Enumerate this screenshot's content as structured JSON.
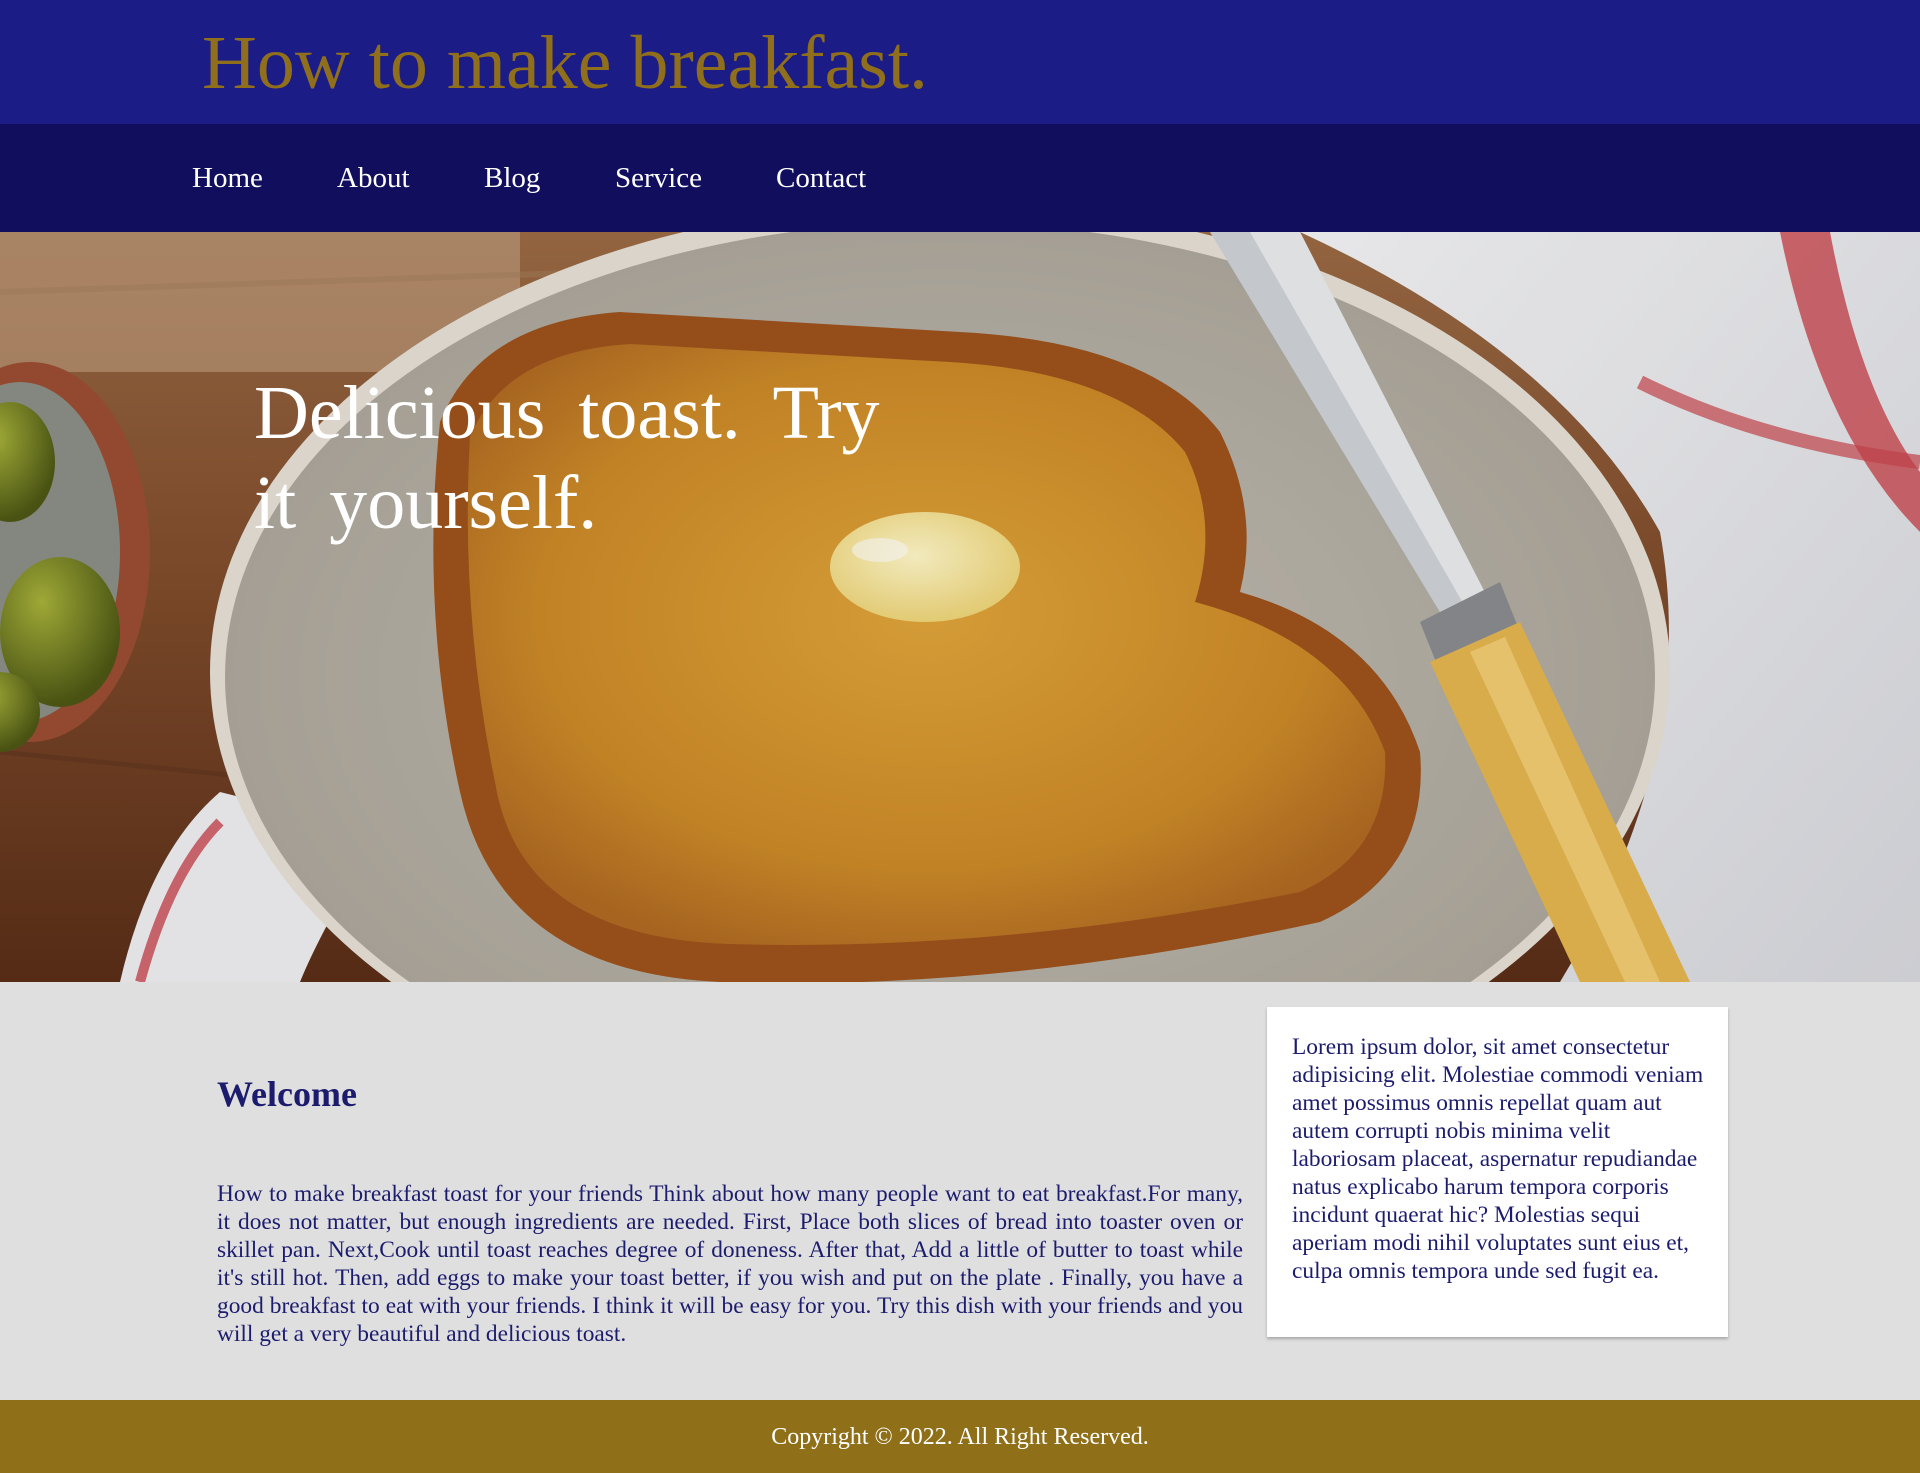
{
  "header": {
    "title": "How to make breakfast."
  },
  "nav": {
    "items": [
      {
        "label": "Home"
      },
      {
        "label": "About"
      },
      {
        "label": "Blog"
      },
      {
        "label": "Service"
      },
      {
        "label": "Contact"
      }
    ]
  },
  "hero": {
    "heading": "Delicious toast. Try it yourself.",
    "image": "toast-with-butter-on-plate"
  },
  "main": {
    "heading": "Welcome",
    "body": "How to make breakfast toast for your friends Think about how many people want to eat breakfast.For many, it does not matter, but enough ingredients are needed. First, Place both slices of bread into toaster oven or skillet pan. Next,Cook until toast reaches degree of doneness. After that, Add a little of butter to toast while it's still hot. Then, add eggs to make your toast better, if you wish and put on the plate . Finally, you have a good breakfast to eat with your friends. I think it will be easy for you. Try this dish with your friends and you will get a very beautiful and delicious toast."
  },
  "sidebar": {
    "text": "Lorem ipsum dolor, sit amet consectetur adipisicing elit. Molestiae commodi veniam amet possimus omnis repellat quam aut autem corrupti nobis minima velit laboriosam placeat, aspernatur repudiandae natus explicabo harum tempora corporis incidunt quaerat hic? Molestias sequi aperiam modi nihil voluptates sunt eius et, culpa omnis tempora unde sed fugit ea."
  },
  "footer": {
    "copyright": "Copyright © 2022. All Right Reserved."
  },
  "colors": {
    "header_bg": "#1c1c86",
    "nav_bg": "#110f5d",
    "title_gold": "#8f6f1c",
    "text_navy": "#1c1c6e",
    "page_bg": "#dfdfdf",
    "footer_bg": "#8f6f18"
  }
}
